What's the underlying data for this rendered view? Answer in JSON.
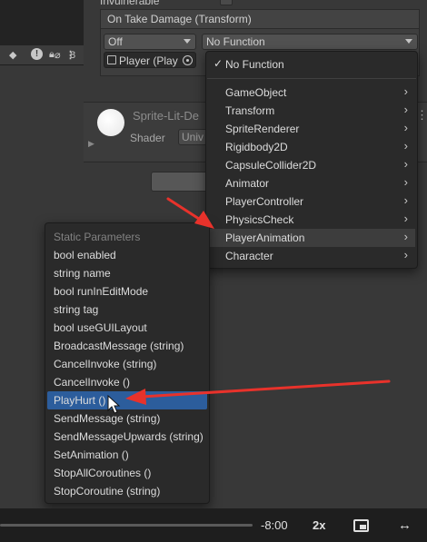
{
  "hierarchy": {
    "toolbar_icons": [
      "lock-icon",
      "kebab-icon",
      "tag-icon",
      "warning-icon",
      "eye-slash-icon"
    ],
    "hidden_count": "8"
  },
  "inspector": {
    "invulnerable_label": "Invulnerable",
    "event": {
      "title": "On Take Damage (Transform)",
      "runtime_value": "Off",
      "function_value": "No Function",
      "object_value": "Player (Play"
    },
    "material": {
      "name": "Sprite-Lit-De",
      "shader_label": "Shader",
      "shader_value": "Univ"
    }
  },
  "function_menu": {
    "checked_item": "No Function",
    "items": [
      "GameObject",
      "Transform",
      "SpriteRenderer",
      "Rigidbody2D",
      "CapsuleCollider2D",
      "Animator",
      "PlayerController",
      "PhysicsCheck",
      "PlayerAnimation",
      "Character"
    ],
    "highlighted": "PlayerAnimation"
  },
  "static_menu": {
    "header": "Static Parameters",
    "items": [
      "bool enabled",
      "string name",
      "bool runInEditMode",
      "string tag",
      "bool useGUILayout",
      "BroadcastMessage (string)",
      "CancelInvoke (string)",
      "CancelInvoke ()",
      "PlayHurt ()",
      "SendMessage (string)",
      "SendMessageUpwards (string)",
      "SetAnimation ()",
      "StopAllCoroutines ()",
      "StopCoroutine (string)"
    ],
    "selected": "PlayHurt ()"
  },
  "player": {
    "time": "-8:00",
    "speed": "2x"
  },
  "colors": {
    "selection": "#2c5d9c",
    "annotation_arrow": "#e8322b"
  }
}
